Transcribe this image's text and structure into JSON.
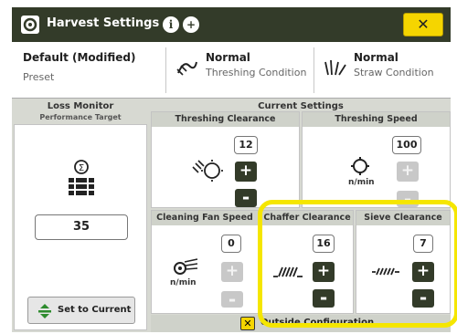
{
  "window": {
    "title": "Harvest Settings",
    "close_label": "✕"
  },
  "header_icons": {
    "info": "i",
    "add": "+"
  },
  "preset": {
    "value": "Default (Modified)",
    "label": "Preset"
  },
  "threshing_condition": {
    "value": "Normal",
    "label": "Threshing Condition",
    "icon": "threshing-condition-icon"
  },
  "straw_condition": {
    "value": "Normal",
    "label": "Straw Condition",
    "icon": "straw-condition-icon"
  },
  "loss_monitor": {
    "title": "Loss Monitor",
    "subtitle": "Performance Target",
    "value": "35",
    "set_button": "Set to Current"
  },
  "current_settings": {
    "title": "Current Settings"
  },
  "threshing_clearance": {
    "label": "Threshing Clearance",
    "value": "12"
  },
  "threshing_speed": {
    "label": "Threshing Speed",
    "value": "100",
    "unit": "n/min"
  },
  "cleaning_fan_speed": {
    "label": "Cleaning Fan Speed",
    "value": "0",
    "unit": "n/min"
  },
  "chaffer_clearance": {
    "label": "Chaffer Clearance",
    "value": "16"
  },
  "sieve_clearance": {
    "label": "Sieve Clearance",
    "value": "7"
  },
  "footer": {
    "outside_configuration": "Outside Configuration"
  },
  "colors": {
    "title_bar": "#333b29",
    "close_button": "#f5d500",
    "highlight": "#f5e600",
    "panel_bg": "#d7d9d2"
  }
}
